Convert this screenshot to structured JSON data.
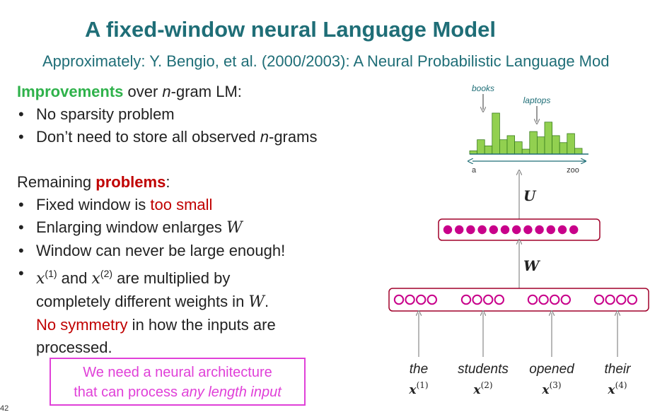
{
  "title": "A fixed-window neural Language Model",
  "subtitle": "Approximately: Y. Bengio, et al. (2000/2003): A Neural Probabilistic Language Mod",
  "improvements": {
    "heading_emph": "Improvements",
    "heading_rest_1": " over ",
    "heading_n": "n",
    "heading_rest_2": "-gram LM:",
    "bullet1": "No sparsity problem",
    "bullet2_a": "Don’t need to store all observed ",
    "bullet2_n": "n",
    "bullet2_b": "-grams"
  },
  "remaining": {
    "heading_a": "Remaining ",
    "heading_emph": "problems",
    "heading_b": ":",
    "b1_a": "Fixed window is ",
    "b1_red": "too small",
    "b2_a": "Enlarging window enlarges ",
    "b2_w": "W",
    "b3": "Window can never be large enough!",
    "b4_x": "x",
    "b4_sup1": "(1)",
    "b4_and": " and ",
    "b4_sup2": "(2)",
    "b4_rest": " are multiplied by",
    "b4_line2_a": "completely different weights in ",
    "b4_line2_w": "W",
    "b4_line2_b": ".",
    "b4_line3_red": "No symmetry",
    "b4_line3_b": " in how the inputs are",
    "b4_line4": "processed."
  },
  "callout": {
    "line1": "We need a neural architecture",
    "line2_a": "that can process ",
    "line2_emph": "any length input"
  },
  "slide_number": "42",
  "diagram": {
    "histogram_labels": {
      "books": "books",
      "laptops": "laptops",
      "axis_start": "a",
      "axis_end": "zoo"
    },
    "histogram_values": [
      0.08,
      0.35,
      0.2,
      1.0,
      0.35,
      0.45,
      0.3,
      0.12,
      0.55,
      0.42,
      0.78,
      0.45,
      0.28,
      0.5,
      0.14
    ],
    "weight_U": "U",
    "weight_W": "W",
    "hidden_units": 12,
    "input_groups": 4,
    "units_per_group": 4,
    "inputs": [
      {
        "word": "the",
        "x": "x",
        "idx": "(1)"
      },
      {
        "word": "students",
        "x": "x",
        "idx": "(2)"
      },
      {
        "word": "opened",
        "x": "x",
        "idx": "(3)"
      },
      {
        "word": "their",
        "x": "x",
        "idx": "(4)"
      }
    ],
    "colors": {
      "bar": "#92d050",
      "bar_stroke": "#3a7d1e",
      "box": "#a0002a",
      "dot": "#c8008a",
      "arrow": "#888888",
      "axis": "#1f6e77"
    }
  }
}
